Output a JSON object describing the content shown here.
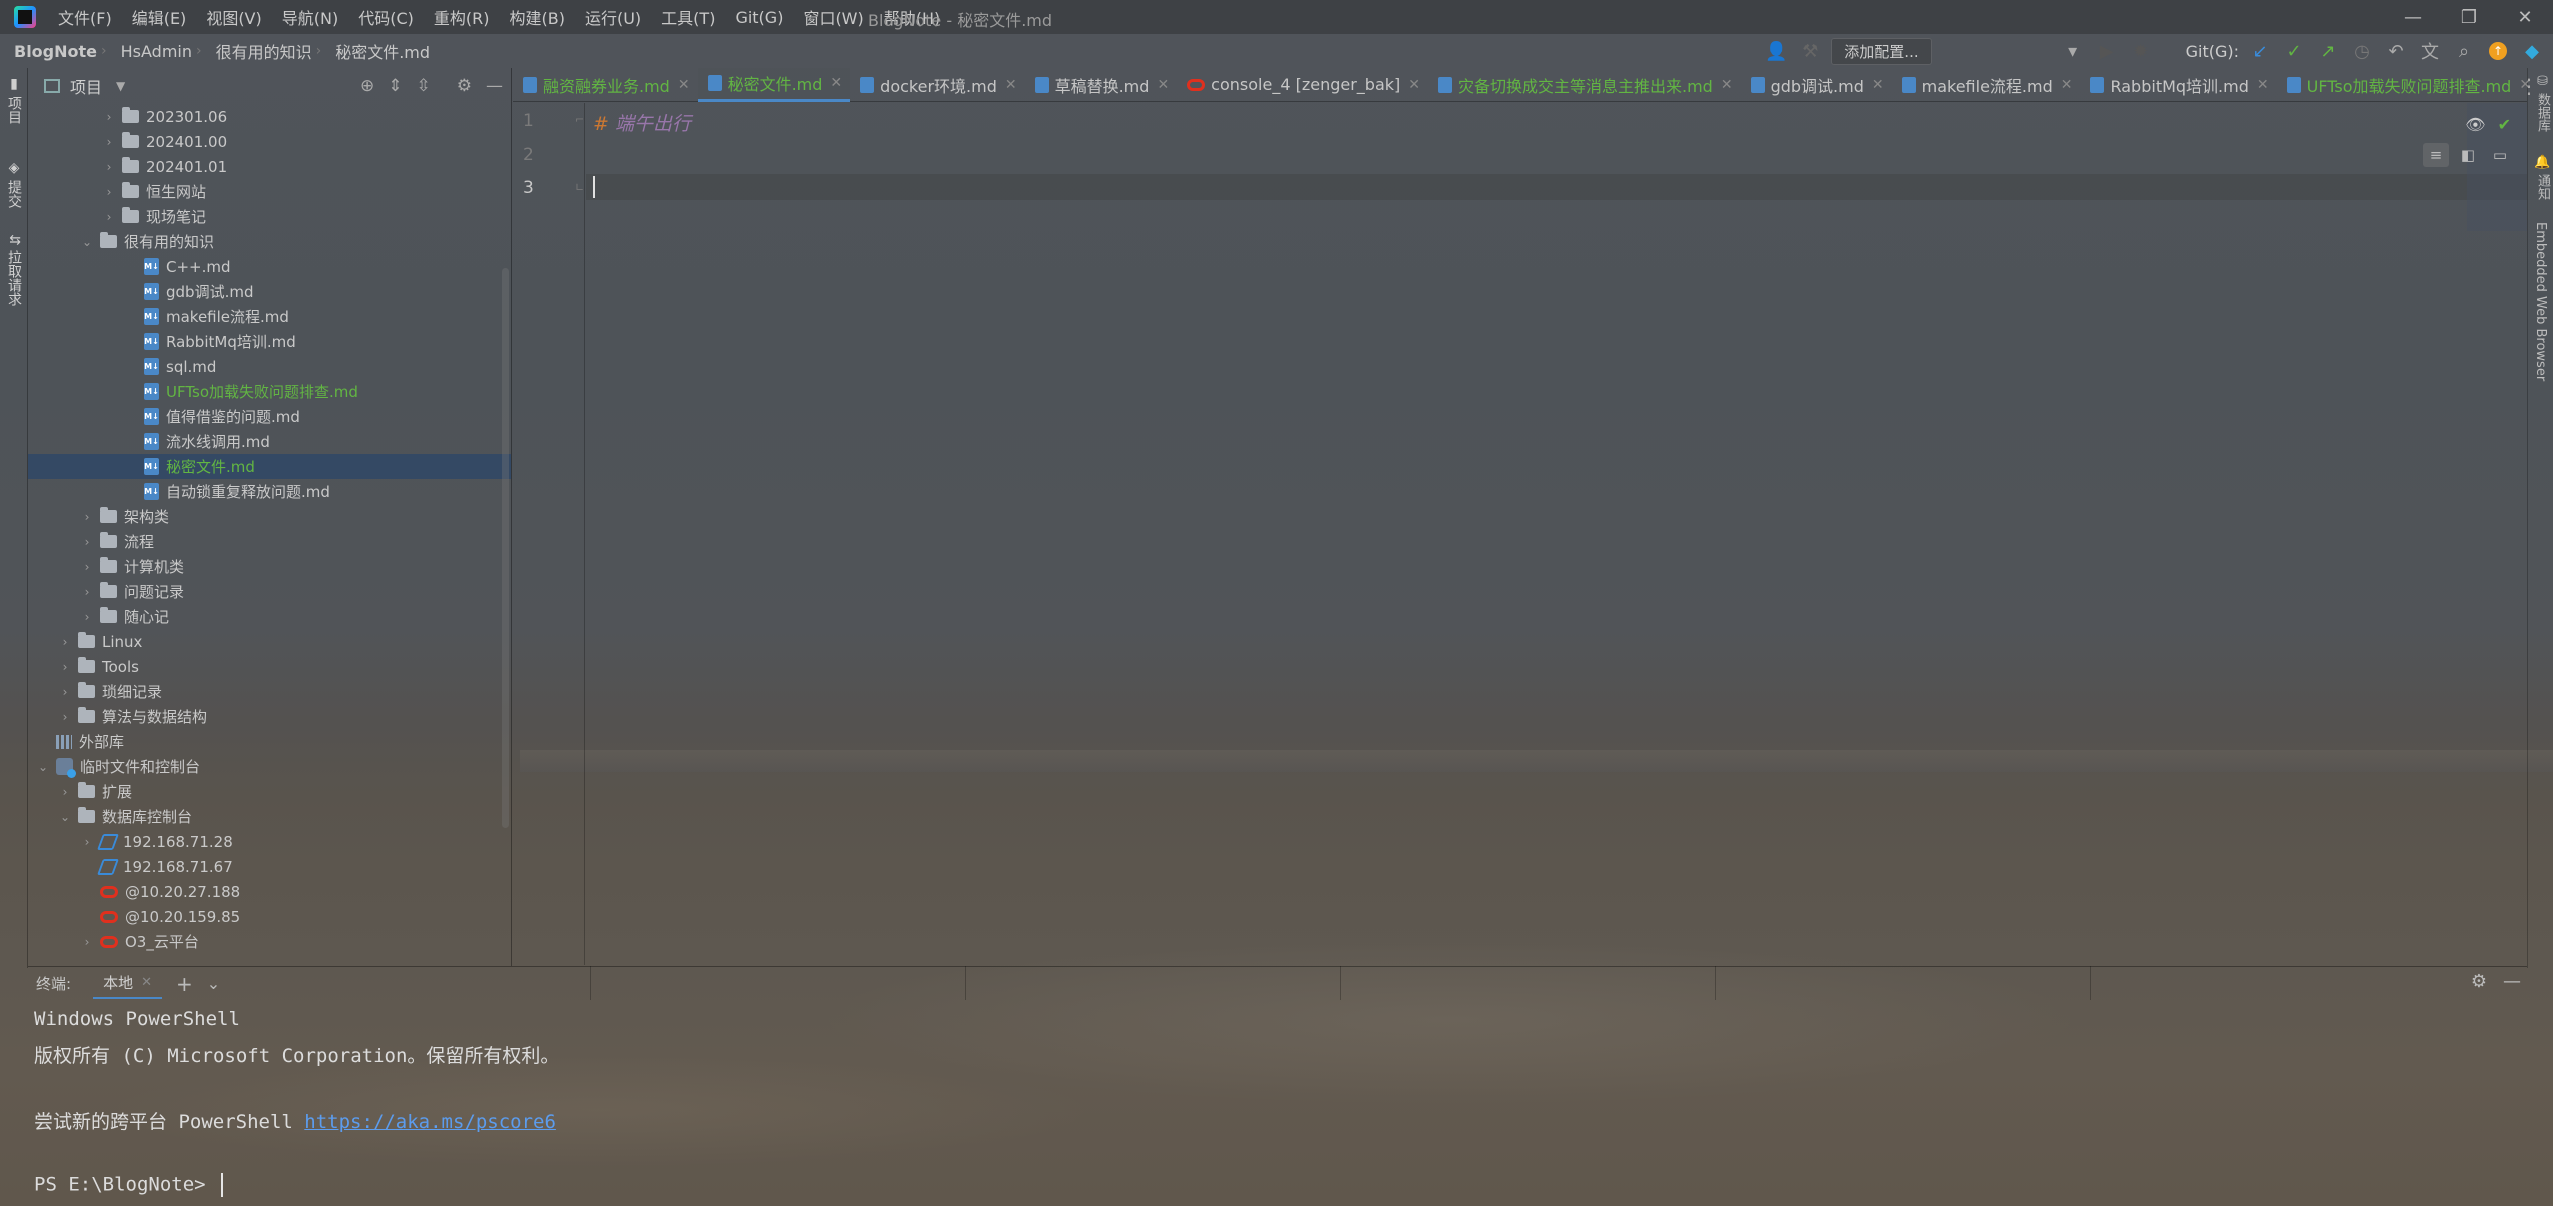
{
  "menubar": {
    "items": [
      "文件(F)",
      "编辑(E)",
      "视图(V)",
      "导航(N)",
      "代码(C)",
      "重构(R)",
      "构建(B)",
      "运行(U)",
      "工具(T)",
      "Git(G)",
      "窗口(W)",
      "帮助(H)"
    ],
    "window_title": "BlogNote - 秘密文件.md"
  },
  "navbar": {
    "crumbs": [
      "BlogNote",
      "HsAdmin",
      "很有用的知识",
      "秘密文件.md"
    ],
    "add_config": "添加配置...",
    "git_label": "Git(G):"
  },
  "left_strip": {
    "tabs": [
      "项目",
      "提交",
      "拉取请求"
    ]
  },
  "right_strip": {
    "tabs": [
      "数据库",
      "通知",
      "Embedded Web Browser"
    ]
  },
  "project": {
    "title": "项目",
    "tree": [
      {
        "label": "202301.06",
        "type": "folder",
        "depth": 3,
        "collapsed": true
      },
      {
        "label": "202401.00",
        "type": "folder",
        "depth": 3,
        "collapsed": true
      },
      {
        "label": "202401.01",
        "type": "folder",
        "depth": 3,
        "collapsed": true
      },
      {
        "label": "恒生网站",
        "type": "folder",
        "depth": 3,
        "collapsed": true
      },
      {
        "label": "现场笔记",
        "type": "folder",
        "depth": 3,
        "collapsed": true
      },
      {
        "label": "很有用的知识",
        "type": "folder",
        "depth": 2,
        "collapsed": false
      },
      {
        "label": "C++.md",
        "type": "md",
        "depth": 4
      },
      {
        "label": "gdb调试.md",
        "type": "md",
        "depth": 4
      },
      {
        "label": "makefile流程.md",
        "type": "md",
        "depth": 4
      },
      {
        "label": "RabbitMq培训.md",
        "type": "md",
        "depth": 4
      },
      {
        "label": "sql.md",
        "type": "md",
        "depth": 4
      },
      {
        "label": "UFTso加载失败问题排查.md",
        "type": "md",
        "depth": 4,
        "green": true
      },
      {
        "label": "值得借鉴的问题.md",
        "type": "md",
        "depth": 4
      },
      {
        "label": "流水线调用.md",
        "type": "md",
        "depth": 4
      },
      {
        "label": "秘密文件.md",
        "type": "md",
        "depth": 4,
        "green": true,
        "selected": true
      },
      {
        "label": "自动锁重复释放问题.md",
        "type": "md",
        "depth": 4
      },
      {
        "label": "架构类",
        "type": "folder",
        "depth": 2,
        "collapsed": true
      },
      {
        "label": "流程",
        "type": "folder",
        "depth": 2,
        "collapsed": true
      },
      {
        "label": "计算机类",
        "type": "folder",
        "depth": 2,
        "collapsed": true
      },
      {
        "label": "问题记录",
        "type": "folder",
        "depth": 2,
        "collapsed": true
      },
      {
        "label": "随心记",
        "type": "folder",
        "depth": 2,
        "collapsed": true
      },
      {
        "label": "Linux",
        "type": "folder",
        "depth": 1,
        "collapsed": true
      },
      {
        "label": "Tools",
        "type": "folder",
        "depth": 1,
        "collapsed": true
      },
      {
        "label": "琐细记录",
        "type": "folder",
        "depth": 1,
        "collapsed": true
      },
      {
        "label": "算法与数据结构",
        "type": "folder",
        "depth": 1,
        "collapsed": true
      },
      {
        "label": "外部库",
        "type": "lib",
        "depth": 0
      },
      {
        "label": "临时文件和控制台",
        "type": "scratch",
        "depth": 0,
        "collapsed": false
      },
      {
        "label": "扩展",
        "type": "folder",
        "depth": 1,
        "collapsed": true
      },
      {
        "label": "数据库控制台",
        "type": "folder",
        "depth": 1,
        "collapsed": false
      },
      {
        "label": "192.168.71.28",
        "type": "db",
        "depth": 2,
        "collapsed": true
      },
      {
        "label": "192.168.71.67",
        "type": "db",
        "depth": 2
      },
      {
        "label": "@10.20.27.188",
        "type": "oracle",
        "depth": 2
      },
      {
        "label": "@10.20.159.85",
        "type": "oracle",
        "depth": 2
      },
      {
        "label": "O3_云平台",
        "type": "oracle",
        "depth": 2,
        "collapsed": true
      }
    ]
  },
  "editor_tabs": [
    {
      "label": "融资融券业务.md",
      "type": "md",
      "green": true
    },
    {
      "label": "秘密文件.md",
      "type": "md",
      "green": true,
      "active": true
    },
    {
      "label": "docker环境.md",
      "type": "md"
    },
    {
      "label": "草稿替换.md",
      "type": "md"
    },
    {
      "label": "console_4 [zenger_bak]",
      "type": "oracle"
    },
    {
      "label": "灾备切换成交主等消息主推出来.md",
      "type": "md",
      "green": true
    },
    {
      "label": "gdb调试.md",
      "type": "md"
    },
    {
      "label": "makefile流程.md",
      "type": "md"
    },
    {
      "label": "RabbitMq培训.md",
      "type": "md"
    },
    {
      "label": "UFTso加载失败问题排查.md",
      "type": "md",
      "green": true
    }
  ],
  "editor": {
    "lines": [
      "1",
      "2",
      "3"
    ],
    "heading_marker": "#",
    "heading_text": "端午出行"
  },
  "terminal": {
    "label": "终端:",
    "tab": "本地",
    "lines": [
      "Windows PowerShell",
      "版权所有 (C) Microsoft Corporation。保留所有权利。",
      "",
      "尝试新的跨平台 PowerShell "
    ],
    "link": "https://aka.ms/pscore6",
    "prompt": "PS E:\\BlogNote> "
  },
  "colors": {
    "accent": "#4a88c7",
    "green_file": "#62b543",
    "selected_row": "#2f4866",
    "oracle_red": "#e0301e"
  }
}
